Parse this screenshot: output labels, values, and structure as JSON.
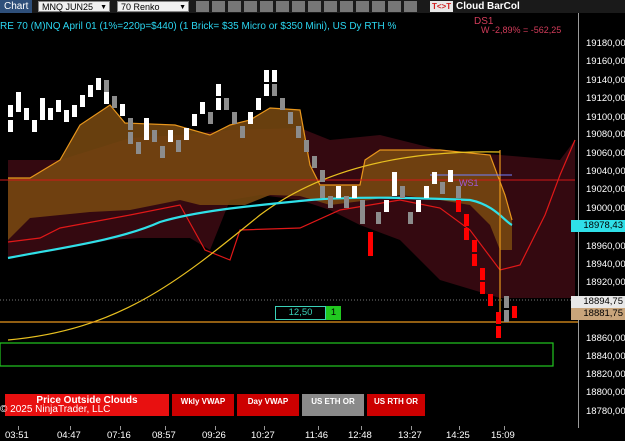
{
  "toolbar": {
    "chart_label": "Chart",
    "instrument": "MNQ JUN25",
    "bar_type": "70 Renko",
    "trade_tag": "T<>T",
    "cloud_link": "Cloud",
    "barcol_link": "BarCol"
  },
  "chart": {
    "title": "RE 70 (M)NQ April 01 (1%=220p=$440) (1 Brick= $35 Micro or $350 Mini), US Dy RTH %",
    "ds_title": "DS1",
    "ds_value": "W -2,89% = -562,25",
    "wsi_label": "WS1",
    "copyright": "© 2025 NinjaTrader, LLC"
  },
  "price_axis": {
    "labels": [
      "19180,00",
      "19160,00",
      "19140,00",
      "19120,00",
      "19100,00",
      "19080,00",
      "19060,00",
      "19040,00",
      "19020,00",
      "19000,00",
      "18960,00",
      "18940,00",
      "18920,00",
      "18900,00",
      "18860,00",
      "18840,00",
      "18820,00",
      "18800,00",
      "18780,00"
    ],
    "tags": [
      {
        "text": "18978,43",
        "color": "#2fe0e8"
      },
      {
        "text": "18894,75",
        "color": "#e8e8e8"
      },
      {
        "text": "18881,75",
        "color": "#c9a57b"
      }
    ]
  },
  "time_axis": {
    "labels": [
      "03:51",
      "04:47",
      "07:16",
      "08:57",
      "09:26",
      "10:27",
      "11:46",
      "12:48",
      "13:27",
      "14:25",
      "15:09"
    ]
  },
  "order": {
    "price": "12,50",
    "qty": "1"
  },
  "buttons": [
    {
      "label": "Price Outside Clouds",
      "color": "#e81010"
    },
    {
      "label": "Wkly VWAP",
      "color": "#cc0000"
    },
    {
      "label": "Day VWAP",
      "color": "#cc0000"
    },
    {
      "label": "US ETH OR",
      "color": "#8a8a8a"
    },
    {
      "label": "US RTH OR",
      "color": "#cc0000"
    }
  ],
  "colors": {
    "up_brick": "#ffffff",
    "down_brick": "#ff0000",
    "dim_brick": "#8c8c8c",
    "cyan_line": "#2fe0e8",
    "orange_line": "#e8961c",
    "yellow_line": "#e8c020",
    "cloud_red": "#3a0a12",
    "cloud_orange": "#7a4a10"
  }
}
